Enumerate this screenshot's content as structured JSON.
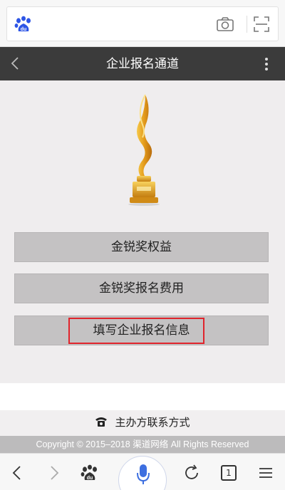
{
  "header": {
    "title": "企业报名通道"
  },
  "menu": {
    "items": [
      {
        "label": "金锐奖权益"
      },
      {
        "label": "金锐奖报名费用"
      },
      {
        "label": "填写企业报名信息"
      }
    ],
    "highlighted_index": 2,
    "highlight_color": "#e0242c"
  },
  "footer": {
    "contact_label": "主办方联系方式",
    "copyright": "Copyright © 2015–2018 渠道网络 All Rights Reserved"
  },
  "toolbar": {
    "tab_count": "1"
  },
  "icons": [
    "baidu-paw-icon",
    "camera-icon",
    "scan-icon",
    "back-arrow-icon",
    "more-vertical-icon",
    "trophy-image",
    "phone-icon",
    "back-icon",
    "forward-icon",
    "home-icon",
    "mic-icon",
    "refresh-icon",
    "tabs-icon",
    "menu-icon"
  ]
}
